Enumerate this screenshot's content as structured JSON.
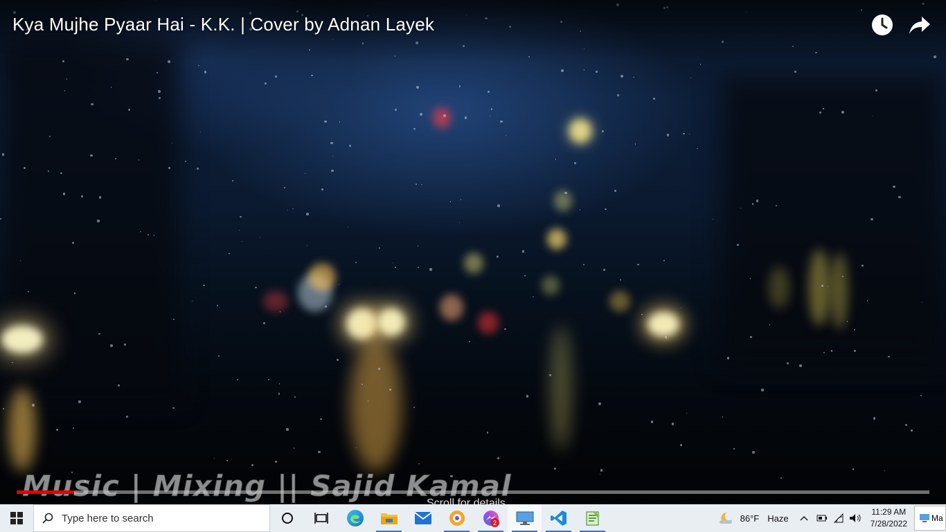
{
  "video": {
    "title": "Kya Mujhe Pyaar Hai - K.K. | Cover by Adnan Layek",
    "credit_overlay": "Music | Mixing || Sajid Kamal",
    "scroll_hint": "Scroll for details",
    "progress": 0.063,
    "buffered": 0.063,
    "watch_later_icon": "clock-icon",
    "share_icon": "share-arrow-icon",
    "colors": {
      "progress": "#e60000",
      "title": "#ffffff"
    }
  },
  "taskbar": {
    "search_placeholder": "Type here to search",
    "apps": [
      {
        "name": "cortana",
        "icon": "cortana-circle-icon"
      },
      {
        "name": "task-view",
        "icon": "task-view-icon"
      },
      {
        "name": "edge",
        "icon": "edge-icon"
      },
      {
        "name": "file-explorer",
        "icon": "folder-icon"
      },
      {
        "name": "mail",
        "icon": "mail-icon"
      },
      {
        "name": "brave",
        "icon": "brave-icon"
      },
      {
        "name": "messenger",
        "icon": "messenger-icon",
        "badge": "2"
      },
      {
        "name": "remote-desktop",
        "icon": "remote-desktop-icon"
      },
      {
        "name": "vs-code",
        "icon": "vscode-icon"
      },
      {
        "name": "notepad-plus",
        "icon": "notepad-icon"
      }
    ],
    "weather": {
      "temp": "86°F",
      "condition": "Haze"
    },
    "clock": {
      "time": "11:29 AM",
      "date": "7/28/2022"
    },
    "notif_label": "Ma"
  }
}
